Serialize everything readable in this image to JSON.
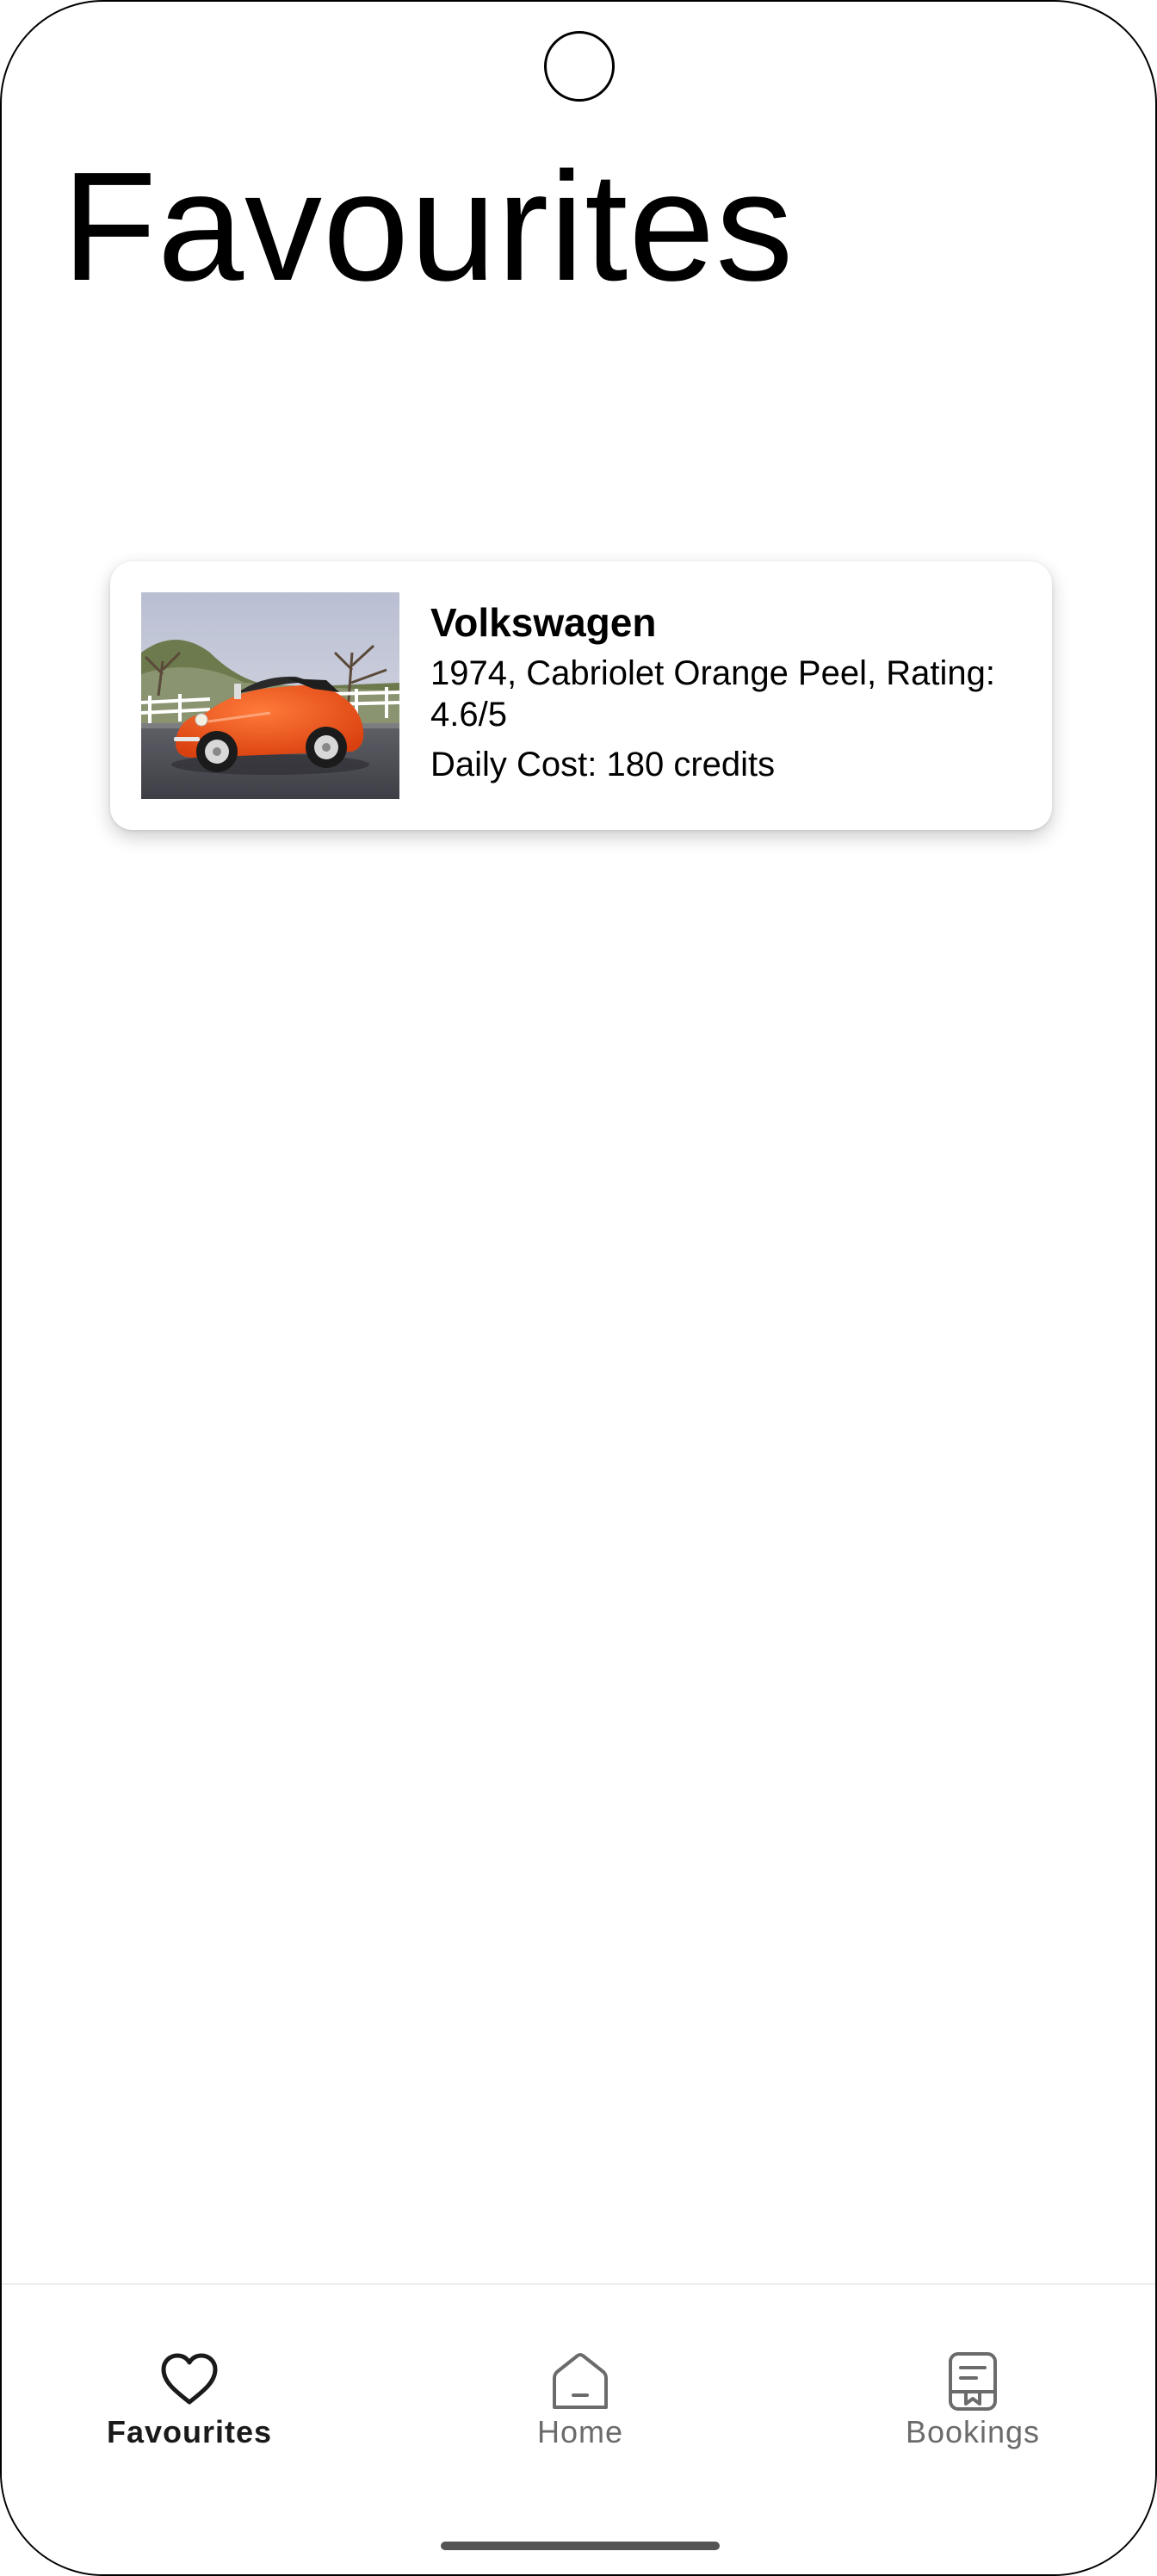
{
  "page": {
    "title": "Favourites"
  },
  "favourites": [
    {
      "make": "Volkswagen",
      "details": "1974, Cabriolet Orange Peel, Rating: 4.6/5",
      "cost": "Daily Cost: 180 credits",
      "image": "orange-cabriolet-car-photo"
    }
  ],
  "bottom_nav": {
    "items": [
      {
        "label": "Favourites",
        "icon": "heart-icon",
        "active": true
      },
      {
        "label": "Home",
        "icon": "home-icon",
        "active": false
      },
      {
        "label": "Bookings",
        "icon": "book-icon",
        "active": false
      }
    ]
  },
  "colors": {
    "active_nav": "#1a1a1a",
    "inactive_nav": "#6b6b6b",
    "car_body": "#e8501c"
  }
}
